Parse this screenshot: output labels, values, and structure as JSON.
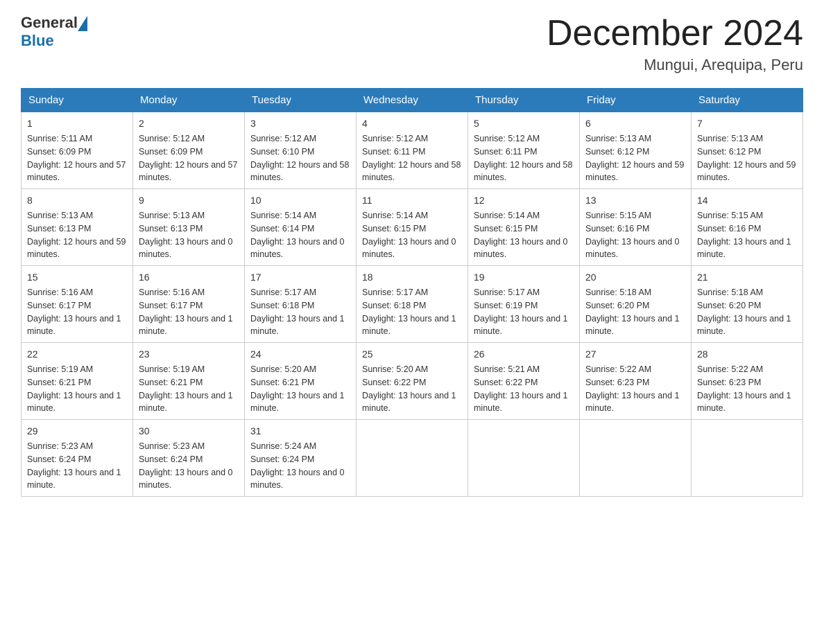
{
  "header": {
    "title": "December 2024",
    "location": "Mungui, Arequipa, Peru",
    "logo_general": "General",
    "logo_blue": "Blue"
  },
  "weekdays": [
    "Sunday",
    "Monday",
    "Tuesday",
    "Wednesday",
    "Thursday",
    "Friday",
    "Saturday"
  ],
  "weeks": [
    [
      {
        "day": "1",
        "sunrise": "5:11 AM",
        "sunset": "6:09 PM",
        "daylight": "12 hours and 57 minutes."
      },
      {
        "day": "2",
        "sunrise": "5:12 AM",
        "sunset": "6:09 PM",
        "daylight": "12 hours and 57 minutes."
      },
      {
        "day": "3",
        "sunrise": "5:12 AM",
        "sunset": "6:10 PM",
        "daylight": "12 hours and 58 minutes."
      },
      {
        "day": "4",
        "sunrise": "5:12 AM",
        "sunset": "6:11 PM",
        "daylight": "12 hours and 58 minutes."
      },
      {
        "day": "5",
        "sunrise": "5:12 AM",
        "sunset": "6:11 PM",
        "daylight": "12 hours and 58 minutes."
      },
      {
        "day": "6",
        "sunrise": "5:13 AM",
        "sunset": "6:12 PM",
        "daylight": "12 hours and 59 minutes."
      },
      {
        "day": "7",
        "sunrise": "5:13 AM",
        "sunset": "6:12 PM",
        "daylight": "12 hours and 59 minutes."
      }
    ],
    [
      {
        "day": "8",
        "sunrise": "5:13 AM",
        "sunset": "6:13 PM",
        "daylight": "12 hours and 59 minutes."
      },
      {
        "day": "9",
        "sunrise": "5:13 AM",
        "sunset": "6:13 PM",
        "daylight": "13 hours and 0 minutes."
      },
      {
        "day": "10",
        "sunrise": "5:14 AM",
        "sunset": "6:14 PM",
        "daylight": "13 hours and 0 minutes."
      },
      {
        "day": "11",
        "sunrise": "5:14 AM",
        "sunset": "6:15 PM",
        "daylight": "13 hours and 0 minutes."
      },
      {
        "day": "12",
        "sunrise": "5:14 AM",
        "sunset": "6:15 PM",
        "daylight": "13 hours and 0 minutes."
      },
      {
        "day": "13",
        "sunrise": "5:15 AM",
        "sunset": "6:16 PM",
        "daylight": "13 hours and 0 minutes."
      },
      {
        "day": "14",
        "sunrise": "5:15 AM",
        "sunset": "6:16 PM",
        "daylight": "13 hours and 1 minute."
      }
    ],
    [
      {
        "day": "15",
        "sunrise": "5:16 AM",
        "sunset": "6:17 PM",
        "daylight": "13 hours and 1 minute."
      },
      {
        "day": "16",
        "sunrise": "5:16 AM",
        "sunset": "6:17 PM",
        "daylight": "13 hours and 1 minute."
      },
      {
        "day": "17",
        "sunrise": "5:17 AM",
        "sunset": "6:18 PM",
        "daylight": "13 hours and 1 minute."
      },
      {
        "day": "18",
        "sunrise": "5:17 AM",
        "sunset": "6:18 PM",
        "daylight": "13 hours and 1 minute."
      },
      {
        "day": "19",
        "sunrise": "5:17 AM",
        "sunset": "6:19 PM",
        "daylight": "13 hours and 1 minute."
      },
      {
        "day": "20",
        "sunrise": "5:18 AM",
        "sunset": "6:20 PM",
        "daylight": "13 hours and 1 minute."
      },
      {
        "day": "21",
        "sunrise": "5:18 AM",
        "sunset": "6:20 PM",
        "daylight": "13 hours and 1 minute."
      }
    ],
    [
      {
        "day": "22",
        "sunrise": "5:19 AM",
        "sunset": "6:21 PM",
        "daylight": "13 hours and 1 minute."
      },
      {
        "day": "23",
        "sunrise": "5:19 AM",
        "sunset": "6:21 PM",
        "daylight": "13 hours and 1 minute."
      },
      {
        "day": "24",
        "sunrise": "5:20 AM",
        "sunset": "6:21 PM",
        "daylight": "13 hours and 1 minute."
      },
      {
        "day": "25",
        "sunrise": "5:20 AM",
        "sunset": "6:22 PM",
        "daylight": "13 hours and 1 minute."
      },
      {
        "day": "26",
        "sunrise": "5:21 AM",
        "sunset": "6:22 PM",
        "daylight": "13 hours and 1 minute."
      },
      {
        "day": "27",
        "sunrise": "5:22 AM",
        "sunset": "6:23 PM",
        "daylight": "13 hours and 1 minute."
      },
      {
        "day": "28",
        "sunrise": "5:22 AM",
        "sunset": "6:23 PM",
        "daylight": "13 hours and 1 minute."
      }
    ],
    [
      {
        "day": "29",
        "sunrise": "5:23 AM",
        "sunset": "6:24 PM",
        "daylight": "13 hours and 1 minute."
      },
      {
        "day": "30",
        "sunrise": "5:23 AM",
        "sunset": "6:24 PM",
        "daylight": "13 hours and 0 minutes."
      },
      {
        "day": "31",
        "sunrise": "5:24 AM",
        "sunset": "6:24 PM",
        "daylight": "13 hours and 0 minutes."
      },
      null,
      null,
      null,
      null
    ]
  ],
  "labels": {
    "sunrise": "Sunrise:",
    "sunset": "Sunset:",
    "daylight": "Daylight:"
  }
}
